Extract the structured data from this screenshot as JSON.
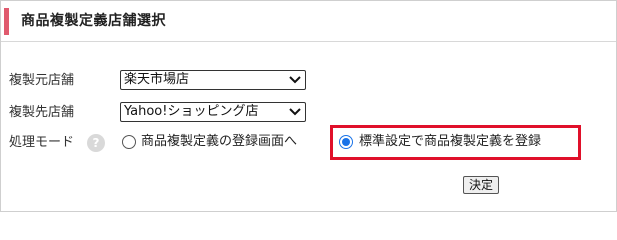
{
  "header": {
    "title": "商品複製定義店舗選択"
  },
  "form": {
    "source_store": {
      "label": "複製元店舗",
      "value": "楽天市場店"
    },
    "target_store": {
      "label": "複製先店舗",
      "value": "Yahoo!ショッピング店"
    },
    "mode": {
      "label": "処理モード",
      "help_icon": "?",
      "options": [
        {
          "label": "商品複製定義の登録画面へ",
          "selected": false
        },
        {
          "label": "標準設定で商品複製定義を登録",
          "selected": true
        }
      ]
    },
    "submit_label": "決定"
  },
  "colors": {
    "accent": "#e05a6e",
    "highlight": "#e0102a",
    "radio_selected": "#1a73e8"
  },
  "icons": {
    "select_chevron": "chevron-down-icon",
    "help": "help-icon"
  }
}
